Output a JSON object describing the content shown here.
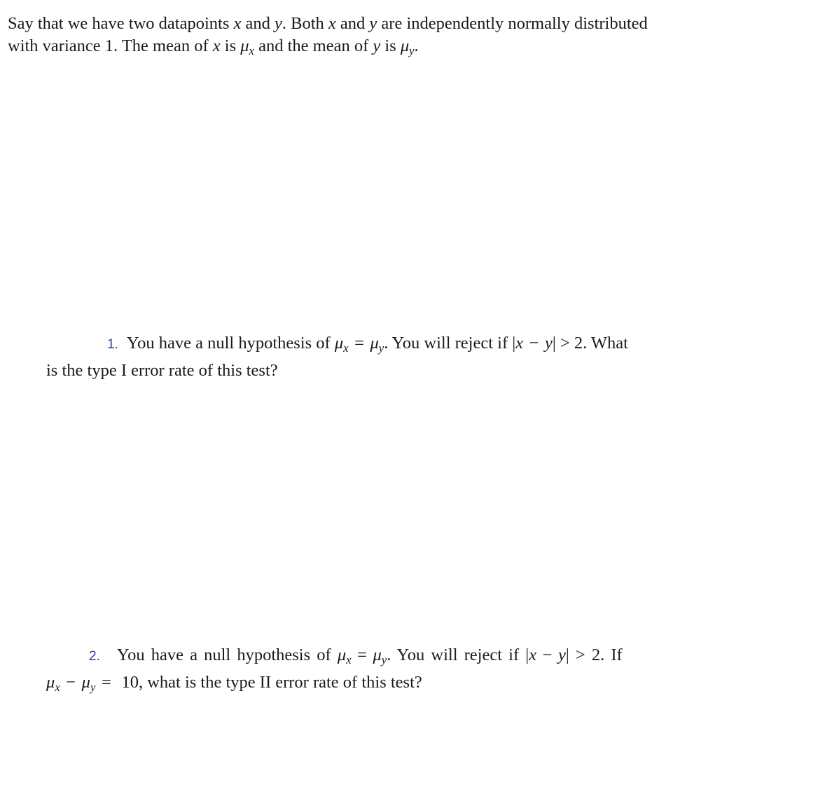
{
  "intro": {
    "line1": {
      "t1": "Say that we have two datapoints ",
      "x": "x",
      "t2": " and ",
      "y": "y",
      "t3": ". Both ",
      "x2": "x",
      "t4": " and ",
      "y2": "y",
      "t5": " are independently normally distributed"
    },
    "line2": {
      "t1": "with variance 1. The mean of ",
      "x": "x",
      "t2": " is ",
      "mu": "μ",
      "mu_sub": "x",
      "t3": " and the mean of ",
      "y": "y",
      "t4": " is ",
      "mu2": "μ",
      "mu2_sub": "y",
      "t5": "."
    }
  },
  "questions": [
    {
      "number": "1.",
      "line1": {
        "t1": "You have a null hypothesis of ",
        "mu": "μ",
        "mu_sub": "x",
        "eq": "=",
        "mu2": "μ",
        "mu2_sub": "y",
        "t2": ".  You will reject if |",
        "x": "x",
        "minus": "−",
        "y": "y",
        "t3": "| > 2. What"
      },
      "line2": "is the type I error rate of this test?"
    },
    {
      "number": "2.",
      "line1": {
        "t1": "You have a null hypothesis of ",
        "mu": "μ",
        "mu_sub": "x",
        "eq": "=",
        "mu2": "μ",
        "mu2_sub": "y",
        "t2": ".  You will reject if |",
        "x": "x",
        "minus": "−",
        "y": "y",
        "t3": "|  >  2. If"
      },
      "line2": {
        "mu": "μ",
        "mu_sub": "x",
        "minus": "−",
        "mu2": "μ",
        "mu2_sub": "y",
        "eq": "=",
        "t1": " 10, what is the type II error rate of this test?"
      }
    }
  ],
  "colors": {
    "text": "#1a1a1a",
    "list_number": "#2a3fa0"
  }
}
